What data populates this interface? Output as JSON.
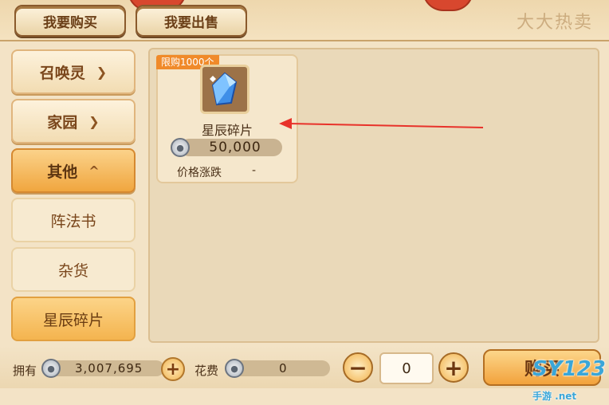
{
  "tabs": {
    "buy": "我要购买",
    "sell": "我要出售"
  },
  "header_logo": "大大热卖",
  "sidebar": {
    "categories": [
      {
        "label": "召唤灵",
        "chevron": "chevron-down-icon"
      },
      {
        "label": "家园",
        "chevron": "chevron-down-icon"
      },
      {
        "label": "其他",
        "chevron": "chevron-up-icon"
      }
    ],
    "subitems": [
      {
        "label": "阵法书"
      },
      {
        "label": "杂货"
      },
      {
        "label": "星辰碎片"
      }
    ],
    "active_subitem": "星辰碎片"
  },
  "item": {
    "limit_badge": "限购1000个",
    "name": "星辰碎片",
    "icon": "crystal-shard-icon",
    "price": "50,000",
    "trend_label": "价格涨跌",
    "trend_value": "-"
  },
  "footer": {
    "owned_label": "拥有",
    "owned_value": "3,007,695",
    "cost_label": "花费",
    "cost_value": "0",
    "quantity": "0",
    "buy_label": "购买",
    "watermark": "SY123",
    "watermark_sub": "手游 .net"
  },
  "colors": {
    "accent": "#f08a2a",
    "arrow": "#e8322a",
    "panel": "#ead9b9"
  }
}
